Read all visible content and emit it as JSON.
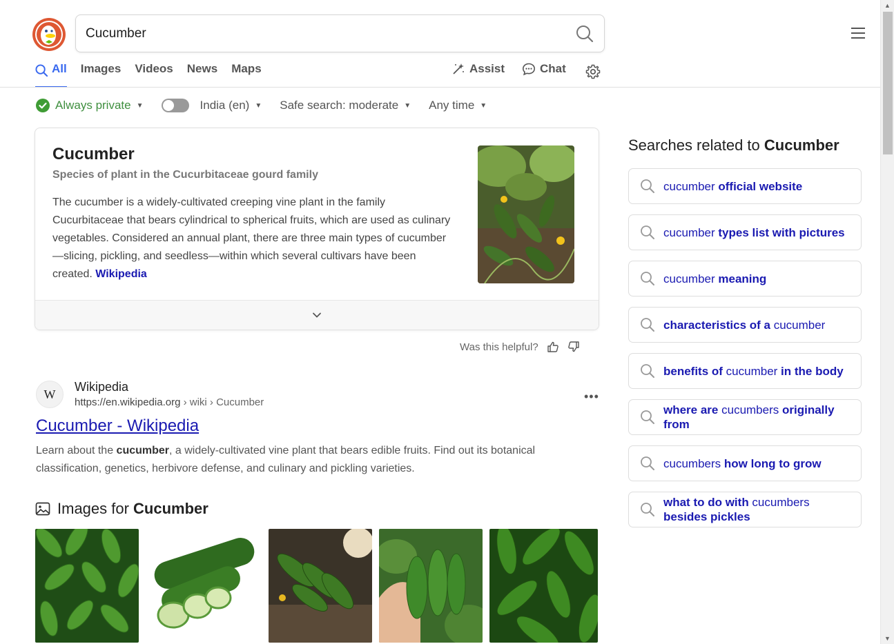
{
  "search": {
    "query": "Cucumber"
  },
  "tabs": [
    {
      "label": "All",
      "active": true
    },
    {
      "label": "Images"
    },
    {
      "label": "Videos"
    },
    {
      "label": "News"
    },
    {
      "label": "Maps"
    }
  ],
  "tools": {
    "assist": "Assist",
    "chat": "Chat"
  },
  "filters": {
    "privacy": "Always private",
    "region": "India (en)",
    "safe_search": "Safe search: moderate",
    "time": "Any time"
  },
  "knowledge_panel": {
    "title": "Cucumber",
    "subtitle": "Species of plant in the Cucurbitaceae gourd family",
    "description": "The cucumber is a widely-cultivated creeping vine plant in the family Cucurbitaceae that bears cylindrical to spherical fruits, which are used as culinary vegetables. Considered an annual plant, there are three main types of cucumber—slicing, pickling, and seedless—within which several cultivars have been created.",
    "source_link": "Wikipedia"
  },
  "feedback": {
    "question": "Was this helpful?"
  },
  "result": {
    "favicon_letter": "W",
    "site": "Wikipedia",
    "url_host": "https://en.wikipedia.org",
    "url_path": " › wiki › Cucumber",
    "title": "Cucumber - Wikipedia",
    "snippet_before": "Learn about the ",
    "snippet_bold": "cucumber",
    "snippet_after": ", a widely-cultivated vine plant that bears edible fruits. Find out its botanical classification, genetics, herbivore defense, and culinary and pickling varieties."
  },
  "images_section": {
    "prefix": "Images for ",
    "query": "Cucumber"
  },
  "related": {
    "title_prefix": "Searches related to ",
    "title_query": "Cucumber",
    "items": [
      {
        "normal": "cucumber ",
        "bold": "official website"
      },
      {
        "normal": "cucumber ",
        "bold": "types list with pictures"
      },
      {
        "normal": "cucumber ",
        "bold": "meaning"
      },
      {
        "bold": "characteristics of a ",
        "normal": "cucumber",
        "bold_first": true
      },
      {
        "bold": "benefits of ",
        "normal": "cucumber ",
        "bold2": "in the body",
        "bold_first": true
      },
      {
        "bold": "where are ",
        "normal": "cucumbers ",
        "bold2": "originally from",
        "bold_first": true
      },
      {
        "normal": "cucumbers ",
        "bold": "how long to grow"
      },
      {
        "bold": "what to do with ",
        "normal": "cucumbers ",
        "bold2": "besides pickles",
        "bold_first": true
      }
    ]
  },
  "colors": {
    "accent": "#3969ef",
    "link": "#1a1ab1",
    "private": "#3f8f3f",
    "brand": "#de5833"
  }
}
